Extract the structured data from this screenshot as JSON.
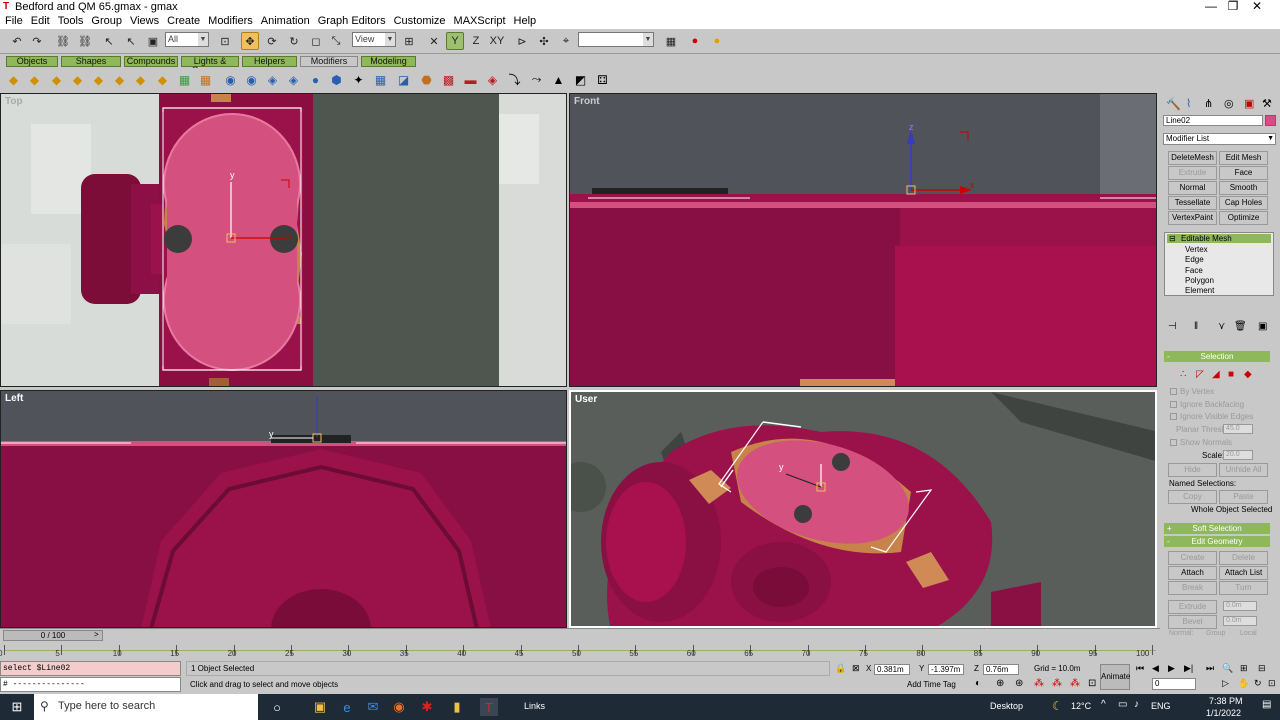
{
  "window": {
    "title": "Bedford and QM 65.gmax - gmax",
    "minimize": "—",
    "maximize": "❐",
    "close": "✕"
  },
  "menu": [
    "File",
    "Edit",
    "Tools",
    "Group",
    "Views",
    "Create",
    "Modifiers",
    "Animation",
    "Graph Editors",
    "Customize",
    "MAXScript",
    "Help"
  ],
  "toolbar": {
    "selection_filter": "All",
    "ref_coord": "View",
    "named_sel": ""
  },
  "tabs": [
    "Objects",
    "Shapes",
    "Compounds",
    "Lights & Cameras",
    "Helpers",
    "Modifiers",
    "Modeling"
  ],
  "selected_tab": "Modifiers",
  "viewports": {
    "top": "Top",
    "front": "Front",
    "left": "Left",
    "user": "User"
  },
  "axis": {
    "x": "x",
    "y": "y",
    "z": "z"
  },
  "cmd": {
    "object_name": "Line02",
    "modifier_list": "Modifier List",
    "buttons": [
      "DeleteMesh",
      "Edit Mesh",
      "Extrude",
      "Face Extrude",
      "Normal",
      "Smooth",
      "Tessellate",
      "Cap Holes",
      "VertexPaint",
      "Optimize"
    ],
    "disabled_buttons": [
      "Extrude"
    ],
    "stack_root": "Editable Mesh",
    "stack_items": [
      "Vertex",
      "Edge",
      "Face",
      "Polygon",
      "Element"
    ],
    "selection_head": "Selection",
    "by_vertex": "By Vertex",
    "ignore_backfacing": "Ignore Backfacing",
    "ignore_visible_edges": "Ignore Visible Edges",
    "planar_thresh": "Planar Thresh:",
    "planar_value": "45.0",
    "show_normals": "Show Normals",
    "scale_label": "Scale:",
    "scale_value": "20.0",
    "hide": "Hide",
    "unhide_all": "Unhide All",
    "named_selections": "Named Selections:",
    "copy": "Copy",
    "paste": "Paste",
    "whole_object": "Whole Object Selected",
    "soft_selection": "Soft Selection",
    "edit_geometry": "Edit Geometry",
    "create": "Create",
    "delete": "Delete",
    "attach": "Attach",
    "attach_list": "Attach List",
    "break": "Break",
    "turn": "Turn",
    "extrude": "Extrude",
    "extrude_val": "0.0m",
    "bevel": "Bevel",
    "bevel_val": "0.0m",
    "normal": "Normal:",
    "group": "Group",
    "local": "Local"
  },
  "time": {
    "frame": "0 / 100",
    "ticks": [
      "0",
      "5",
      "10",
      "15",
      "20",
      "25",
      "30",
      "35",
      "40",
      "45",
      "50",
      "55",
      "60",
      "65",
      "70",
      "75",
      "80",
      "85",
      "90",
      "95",
      "100"
    ]
  },
  "status": {
    "script_line1": "select $Line02",
    "script_line2": "# ---------------",
    "selected": "1 Object Selected",
    "prompt": "Click and drag to select and move objects",
    "x_label": "X",
    "x": "0.381m",
    "y_label": "Y",
    "y": "-1.397m",
    "z_label": "Z",
    "z": "0.76m",
    "grid": "Grid = 10.0m",
    "add_time_tag": "Add Time Tag",
    "animate": "Animate",
    "frame_field": "0"
  },
  "taskbar": {
    "search": "Type here to search",
    "links": "Links",
    "desktop": "Desktop",
    "temp": "12°C",
    "lang": "ENG",
    "time": "7:38 PM",
    "date": "1/1/2022"
  },
  "colors": {
    "mesh": "#9b0f48",
    "selected_face": "#d4507e",
    "orange": "#c7834a",
    "panel_green": "#8fb85a"
  }
}
